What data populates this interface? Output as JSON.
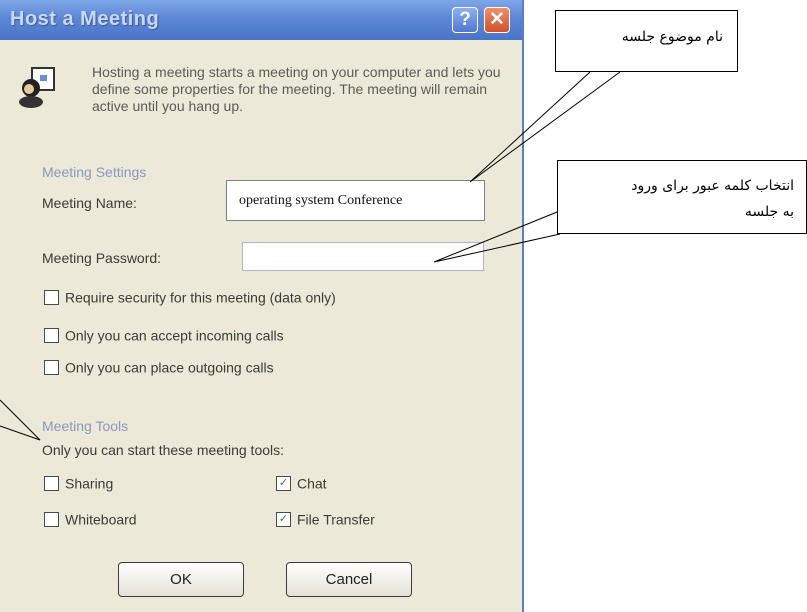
{
  "dialog": {
    "title": "Host a Meeting",
    "help_glyph": "?",
    "close_glyph": "✕",
    "intro": "Hosting a meeting starts a meeting on your computer and lets you define some properties for the meeting. The meeting will remain active until you hang up.",
    "settings": {
      "group_title": "Meeting Settings",
      "name_label": "Meeting Name:",
      "name_value": "operating system Conference",
      "password_label": "Meeting Password:",
      "password_value": ""
    },
    "options": [
      {
        "label": "Require security for this meeting (data only)",
        "checked": false
      },
      {
        "label": "Only you can accept incoming calls",
        "checked": false
      },
      {
        "label": "Only you can place outgoing calls",
        "checked": false
      }
    ],
    "tools": {
      "group_title": "Meeting Tools",
      "subtitle": "Only you can start these meeting tools:",
      "items": [
        {
          "label": "Sharing",
          "checked": false
        },
        {
          "label": "Chat",
          "checked": true
        },
        {
          "label": "Whiteboard",
          "checked": false
        },
        {
          "label": "File Transfer",
          "checked": true
        }
      ]
    },
    "buttons": {
      "ok": "OK",
      "cancel": "Cancel"
    }
  },
  "annotations": {
    "meeting_name": "نام موضوع جلسه",
    "password_line1": "انتخاب کلمه عبور برای ورود",
    "password_line2": "به جلسه"
  },
  "icons": [
    "meeting-icon",
    "help-icon",
    "close-icon",
    "checkbox-check-icon"
  ]
}
